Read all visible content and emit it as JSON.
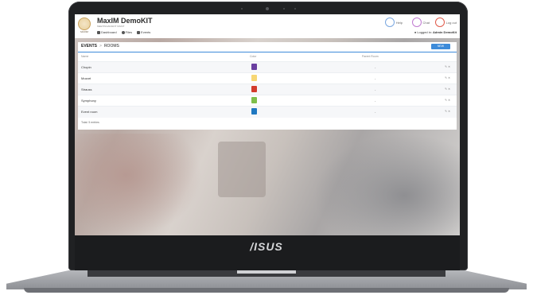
{
  "device": {
    "brand": "/ISUS"
  },
  "header": {
    "app_title": "MaxIM DemoKIT",
    "app_subtitle": "MEETING/EVENT MGMT",
    "logo_caption": "MAXIM",
    "nav": [
      {
        "label": "Dashboard",
        "icon": "home-icon"
      },
      {
        "label": "Files",
        "icon": "gear-icon"
      },
      {
        "label": "Events",
        "icon": "calendar-icon"
      }
    ],
    "top_buttons": [
      {
        "label": "Help",
        "icon": "help-icon",
        "color": "#7aa7e0"
      },
      {
        "label": "Chat",
        "icon": "chat-icon",
        "color": "#c07ad1"
      },
      {
        "label": "Log out",
        "icon": "logout-icon",
        "color": "#e05a4a"
      }
    ],
    "user": {
      "prefix": "Logged in:",
      "name": "Admin DemoKit"
    }
  },
  "page": {
    "breadcrumb": {
      "root": "EVENTS",
      "separator": ">",
      "current": "ROOMS"
    },
    "new_button": "NEW",
    "columns": {
      "name": "Name",
      "color": "Color",
      "parent": "Parent Room"
    },
    "rows": [
      {
        "name": "Chopin",
        "color": "#6a3fa0",
        "parent": "-"
      },
      {
        "name": "Mozart",
        "color": "#f7d774",
        "parent": "-"
      },
      {
        "name": "Strauss",
        "color": "#d33b2c",
        "parent": "-"
      },
      {
        "name": "Symphony",
        "color": "#7fbf4a",
        "parent": "-"
      },
      {
        "name": "Event room",
        "color": "#1f78c1",
        "parent": "-"
      }
    ],
    "footer": "Total: 5 entries"
  }
}
